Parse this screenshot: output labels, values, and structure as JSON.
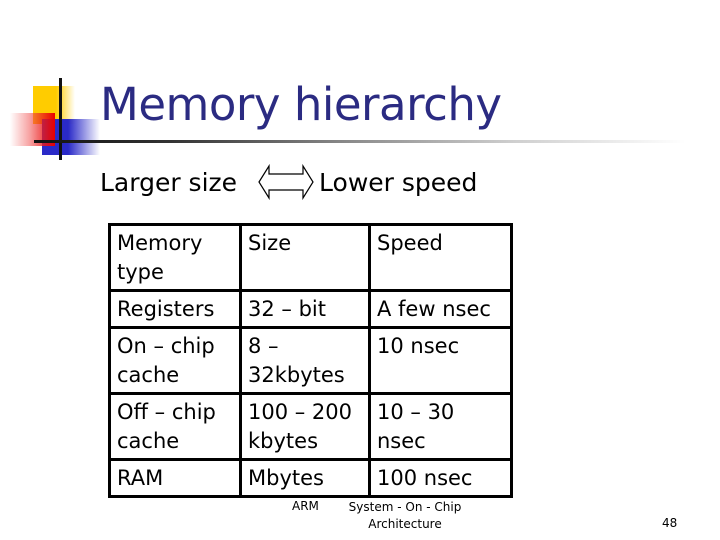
{
  "slide": {
    "title": "Memory hierarchy",
    "subtitle": {
      "left": "Larger size",
      "arrow_icon": "double-arrow-icon",
      "right": "Lower speed"
    },
    "table": {
      "headers": [
        "Memory type",
        "Size",
        "Speed"
      ],
      "rows": [
        [
          "Registers",
          "32 – bit",
          "A few nsec"
        ],
        [
          "On – chip cache",
          "8 – 32kbytes",
          "10 nsec"
        ],
        [
          "Off – chip cache",
          "100 – 200 kbytes",
          "10 – 30 nsec"
        ],
        [
          "RAM",
          "Mbytes",
          "100 nsec"
        ]
      ]
    },
    "footer": {
      "left": "ARM",
      "center": "System - On - Chip Architecture",
      "page_number": "48"
    },
    "colors": {
      "title": "#2b2b82",
      "deco_yellow": "#ffcc00",
      "deco_blue": "#2a2ac8",
      "deco_red": "#e80000"
    }
  }
}
